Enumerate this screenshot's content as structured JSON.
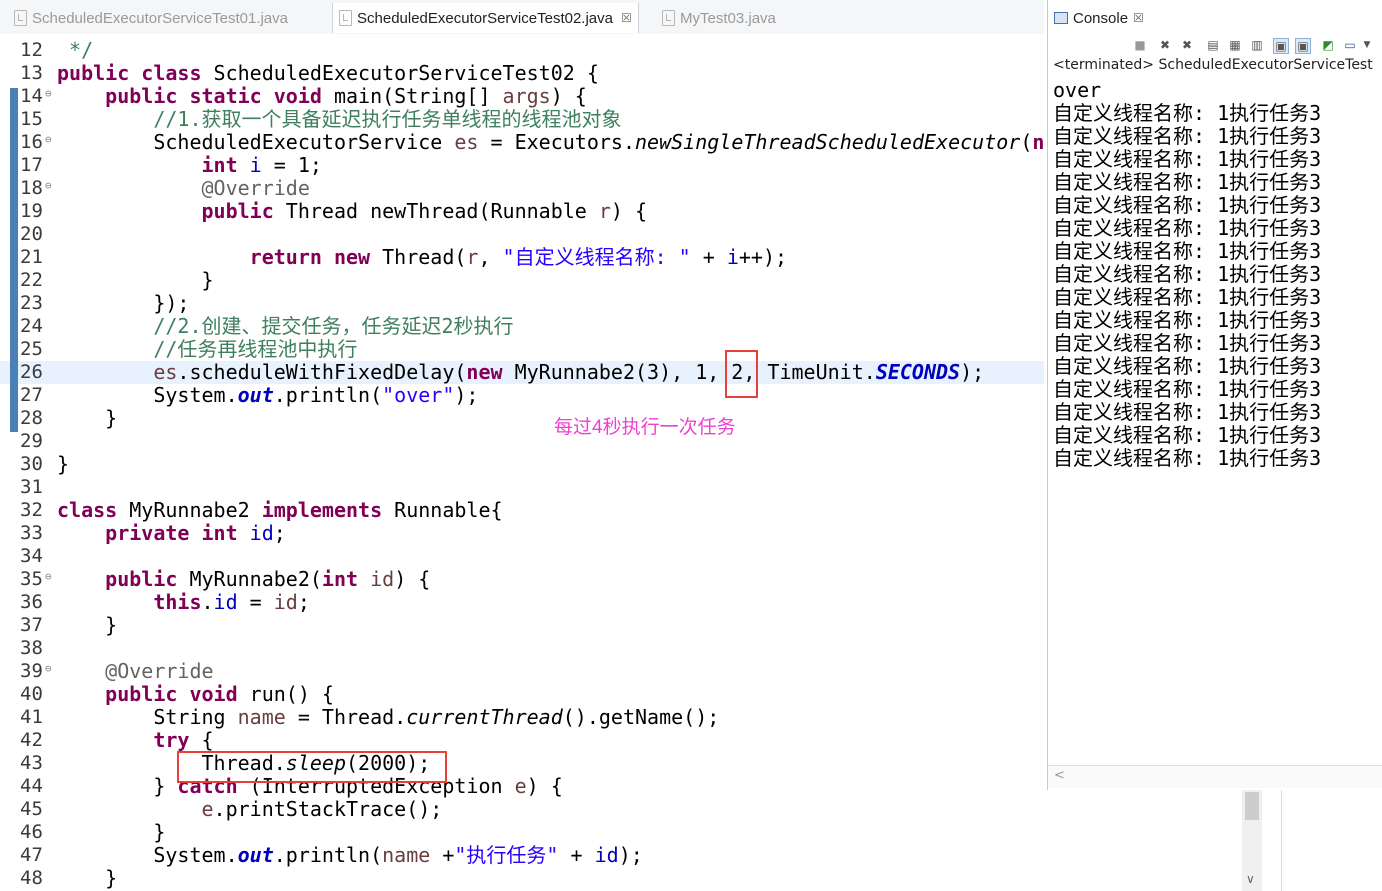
{
  "tabs": [
    {
      "label": "ScheduledExecutorServiceTest01.java",
      "active": false
    },
    {
      "label": "ScheduledExecutorServiceTest02.java",
      "active": true,
      "close": "☒"
    },
    {
      "label": "MyTest03.java",
      "active": false
    }
  ],
  "editor": {
    "lines": [
      {
        "n": "12",
        "html": "<span class=\"cm\"> */</span>"
      },
      {
        "n": "13",
        "html": "<span class=\"kw\">public class</span> ScheduledExecutorServiceTest02 {"
      },
      {
        "n": "14",
        "fold": true,
        "html": "    <span class=\"kw\">public static void</span> main(String[] <span class=\"lv\">args</span>) {"
      },
      {
        "n": "15",
        "html": "        <span class=\"cm\">//1.获取一个具备延迟执行任务单线程的线程池对象</span>"
      },
      {
        "n": "16",
        "fold": true,
        "html": "        ScheduledExecutorService <span class=\"lv\">es</span> = Executors.<span class=\"it\">newSingleThreadScheduledExecutor</span>(<span class=\"kw\">ne</span>"
      },
      {
        "n": "17",
        "html": "            <span class=\"kw\">int</span> <span class=\"fld\">i</span> = 1;"
      },
      {
        "n": "18",
        "fold": true,
        "html": "            <span class=\"ann\">@Override</span>"
      },
      {
        "n": "19",
        "html": "            <span class=\"kw\">public</span> Thread newThread(Runnable <span class=\"lv\">r</span>) {"
      },
      {
        "n": "20",
        "html": ""
      },
      {
        "n": "21",
        "html": "                <span class=\"kw\">return new</span> Thread(<span class=\"lv\">r</span>, <span class=\"str\">\"自定义线程名称: \"</span> + <span class=\"fld\">i</span>++);"
      },
      {
        "n": "22",
        "html": "            }"
      },
      {
        "n": "23",
        "html": "        });"
      },
      {
        "n": "24",
        "html": "        <span class=\"cm\">//2.创建、提交任务，任务延迟2秒执行</span>"
      },
      {
        "n": "25",
        "html": "        <span class=\"cm\">//任务再线程池中执行</span>"
      },
      {
        "n": "26",
        "current": true,
        "html": "        <span class=\"lv\">es</span>.scheduleWithFixedDelay(<span class=\"kw\">new</span> MyRunnabe2(3), 1, 2, TimeUnit.<span class=\"fldit\">SECONDS</span>);"
      },
      {
        "n": "27",
        "html": "        System.<span class=\"fldit\">out</span>.println(<span class=\"str\">\"over\"</span>);"
      },
      {
        "n": "28",
        "html": "    }"
      },
      {
        "n": "29",
        "html": ""
      },
      {
        "n": "30",
        "html": "}"
      },
      {
        "n": "31",
        "html": ""
      },
      {
        "n": "32",
        "html": "<span class=\"kw\">class</span> MyRunnabe2 <span class=\"kw\">implements</span> Runnable{"
      },
      {
        "n": "33",
        "html": "    <span class=\"kw\">private int</span> <span class=\"fld\">id</span>;"
      },
      {
        "n": "34",
        "html": ""
      },
      {
        "n": "35",
        "fold": true,
        "html": "    <span class=\"kw\">public</span> MyRunnabe2(<span class=\"kw\">int</span> <span class=\"lv\">id</span>) {"
      },
      {
        "n": "36",
        "html": "        <span class=\"kw\">this</span>.<span class=\"fld\">id</span> = <span class=\"lv\">id</span>;"
      },
      {
        "n": "37",
        "html": "    }"
      },
      {
        "n": "38",
        "html": ""
      },
      {
        "n": "39",
        "fold": true,
        "html": "    <span class=\"ann\">@Override</span>"
      },
      {
        "n": "40",
        "html": "    <span class=\"kw\">public void</span> run() {"
      },
      {
        "n": "41",
        "html": "        String <span class=\"lv\">name</span> = Thread.<span class=\"it\">currentThread</span>().getName();"
      },
      {
        "n": "42",
        "html": "        <span class=\"kw\">try</span> {"
      },
      {
        "n": "43",
        "html": "            Thread.<span class=\"it\">sleep</span>(2000);"
      },
      {
        "n": "44",
        "html": "        } <span class=\"kw\">catch</span> (InterruptedException <span class=\"lv\">e</span>) {"
      },
      {
        "n": "45",
        "html": "            <span class=\"lv\">e</span>.printStackTrace();"
      },
      {
        "n": "46",
        "html": "        }"
      },
      {
        "n": "47",
        "html": "        System.<span class=\"fldit\">out</span>.println(<span class=\"lv\">name</span> +<span class=\"str\">\"执行任务\"</span> + <span class=\"fld\">id</span>);"
      },
      {
        "n": "48",
        "html": "    }"
      }
    ]
  },
  "annotation": {
    "note": "每过4秒执行一次任务"
  },
  "console": {
    "title": "Console",
    "close": "☒",
    "status": "<terminated> ScheduledExecutorServiceTest",
    "output": [
      "over",
      "自定义线程名称: 1执行任务3",
      "自定义线程名称: 1执行任务3",
      "自定义线程名称: 1执行任务3",
      "自定义线程名称: 1执行任务3",
      "自定义线程名称: 1执行任务3",
      "自定义线程名称: 1执行任务3",
      "自定义线程名称: 1执行任务3",
      "自定义线程名称: 1执行任务3",
      "自定义线程名称: 1执行任务3",
      "自定义线程名称: 1执行任务3",
      "自定义线程名称: 1执行任务3",
      "自定义线程名称: 1执行任务3",
      "自定义线程名称: 1执行任务3",
      "自定义线程名称: 1执行任务3",
      "自定义线程名称: 1执行任务3",
      "自定义线程名称: 1执行任务3"
    ]
  }
}
